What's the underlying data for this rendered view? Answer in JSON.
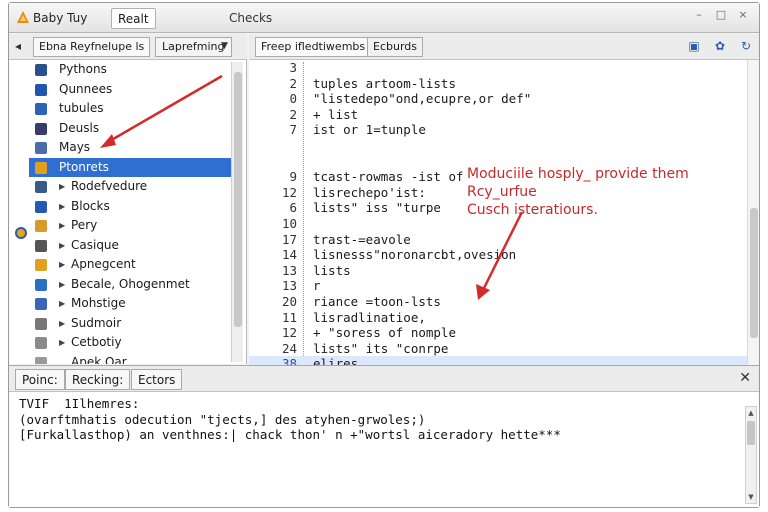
{
  "titlebar": {
    "app_title": "Baby Tuy",
    "tab_label": "Realt",
    "window_title": "Checks",
    "controls": [
      "–",
      "□",
      "×"
    ]
  },
  "left_panel": {
    "back_label": "◂",
    "tab1": "Ebna Reyfnelupe ls",
    "tab2": "Laprefming",
    "dropdown": "▼",
    "items": [
      {
        "label": "Pythons",
        "icon_color": "#2b4f8c"
      },
      {
        "label": "Qunnees",
        "icon_color": "#2055b0"
      },
      {
        "label": "tubules",
        "icon_color": "#2a63b8"
      },
      {
        "label": "Deusls",
        "icon_color": "#3b3b6b"
      },
      {
        "label": "Mays",
        "icon_color": "#4a6ea9"
      },
      {
        "label": "Ptonrets",
        "icon_color": "#e0a020"
      },
      {
        "label": "Rodefvedure",
        "icon_color": "#3a5a8a"
      },
      {
        "label": "Blocks",
        "icon_color": "#2558b3"
      },
      {
        "label": "Pery",
        "icon_color": "#d89a2c"
      },
      {
        "label": "Casique",
        "icon_color": "#555555"
      },
      {
        "label": "Apnegcent",
        "icon_color": "#e0a020"
      },
      {
        "label": "Becale, Ohogenmet",
        "icon_color": "#2a6fc2"
      },
      {
        "label": "Mohstige",
        "icon_color": "#3b66b5"
      },
      {
        "label": "Sudmoir",
        "icon_color": "#777777"
      },
      {
        "label": "Cetbotiy",
        "icon_color": "#8a8a8a"
      },
      {
        "label": "Apek Oar",
        "icon_color": "#999999"
      }
    ],
    "selected_index": 5
  },
  "editor": {
    "tab1": "Freep ifledtiwembs",
    "tab2": "Ecburds",
    "icons": [
      "image-icon",
      "gear-icon",
      "refresh-icon"
    ],
    "lines": [
      {
        "num": "3",
        "text": ""
      },
      {
        "num": "2",
        "text": "tuples artoom-lists"
      },
      {
        "num": "0",
        "text": "\"listedepo\"ond,ecupre,or def\""
      },
      {
        "num": "2",
        "text": "   + list"
      },
      {
        "num": "7",
        "text": "ist or 1=tunple"
      },
      {
        "num": "",
        "text": ""
      },
      {
        "num": "",
        "text": ""
      },
      {
        "num": "9",
        "text": "tcast-rowmas -ist of"
      },
      {
        "num": "12",
        "text": "  lisrechepo'ist:"
      },
      {
        "num": "6",
        "text": "lists\" iss \"turpe"
      },
      {
        "num": "10",
        "text": ""
      },
      {
        "num": "17",
        "text": "trast-=eavole"
      },
      {
        "num": "14",
        "text": "  lisnesss\"noronarcbt,ovesion"
      },
      {
        "num": "13",
        "text": "lists"
      },
      {
        "num": "13",
        "text": "r"
      },
      {
        "num": "20",
        "text": "riance =toon-lsts"
      },
      {
        "num": "11",
        "text": "  lisradlinatioe,"
      },
      {
        "num": "12",
        "text": "   +  \"soress of nomple"
      },
      {
        "num": "24",
        "text": "lists\" its \"conrpe"
      },
      {
        "num": "38",
        "text": "elires"
      }
    ],
    "highlight_line_index": 19,
    "annotation": [
      "Moduciile hosply_ provide them",
      "Rcy_urfue",
      "Cusch isteratiours."
    ]
  },
  "console": {
    "tabs": [
      "Poinc:",
      "Recking:",
      "Ectors"
    ],
    "close": "✕",
    "lines": [
      "TVIF  1Ilhemres:",
      "(ovarftmhatis odecution \"tjects,] des atyhen-grwoles;)",
      "[Furkallasthop) an venthnes:| chack thon' n +\"wortsl aiceradory hette***"
    ]
  },
  "colors": {
    "selection": "#2f6fd1",
    "annotation": "#c52a2a",
    "gutter_marker": "#e7a613"
  }
}
